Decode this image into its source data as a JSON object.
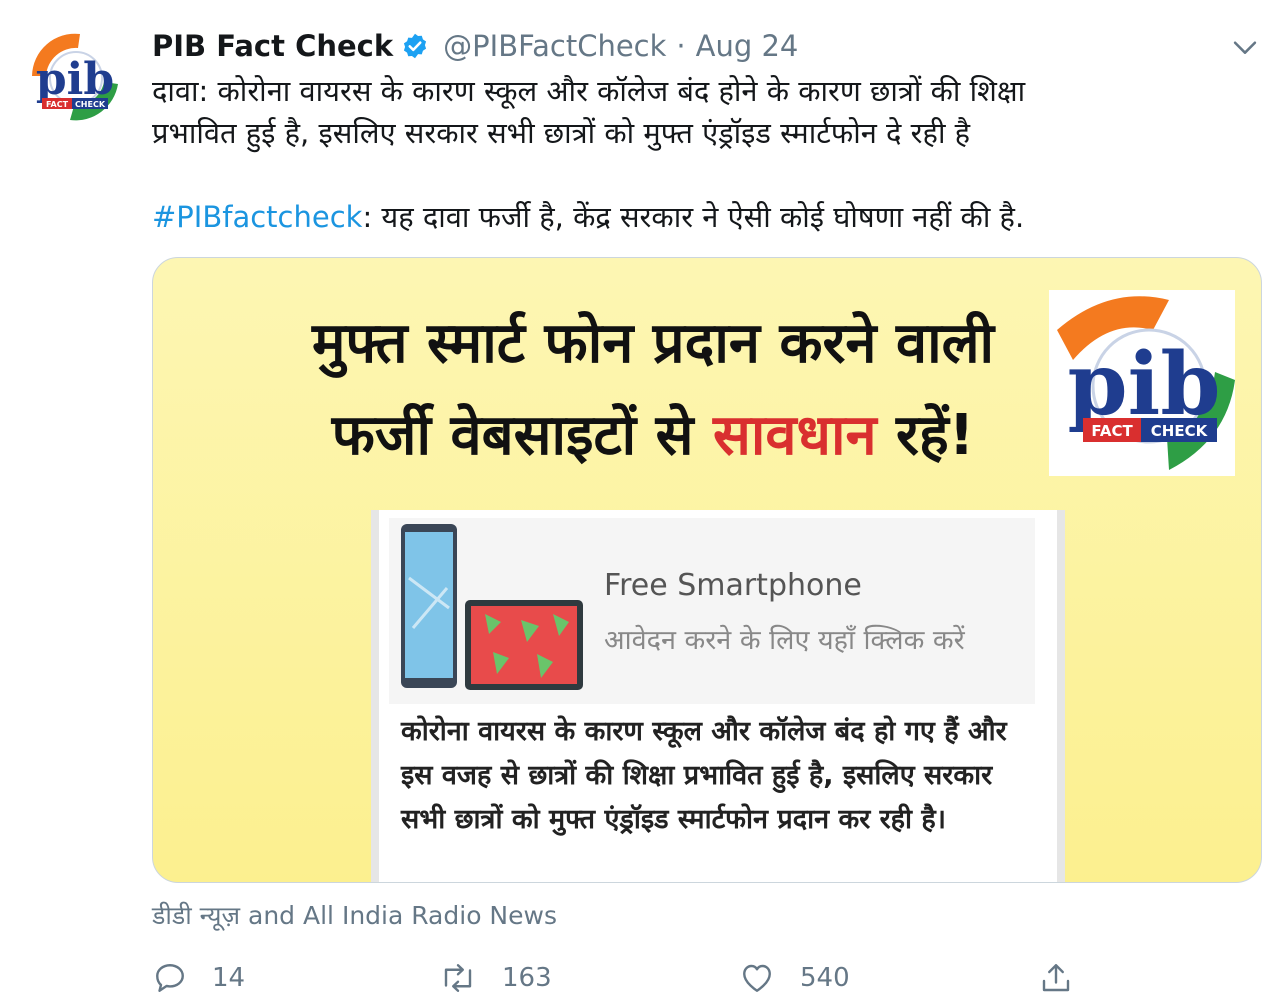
{
  "author": {
    "name": "PIB Fact Check",
    "handle": "@PIBFactCheck",
    "separator": "·",
    "date": "Aug 24",
    "verified": true,
    "avatar_label": "pib",
    "avatar_tag_left": "FACT",
    "avatar_tag_right": "CHECK"
  },
  "tweet": {
    "line1": "दावा: कोरोना वायरस के कारण स्कूल और कॉलेज बंद होने के कारण छात्रों की शिक्षा",
    "line2": "प्रभावित हुई है, इसलिए सरकार सभी छात्रों को मुफ्त एंड्रॉइड स्मार्टफोन दे रही है",
    "hashtag": "#PIBfactcheck",
    "verdict": ": यह दावा फर्जी है, केंद्र सरकार ने ऐसी कोई घोषणा नहीं की है."
  },
  "card": {
    "headline_line1": "मुफ्त स्मार्ट फोन प्रदान करने वाली",
    "headline_line2_pre": "फर्जी वेबसाइटों से ",
    "headline_warn": "सावधान",
    "headline_line2_post": " रहें!",
    "logo_label": "pib",
    "logo_tag_left": "FACT",
    "logo_tag_right": "CHECK",
    "ad_title": "Free Smartphone",
    "ad_subtitle": "आवेदन करने के लिए यहाँ क्लिक करें",
    "fake_message": "कोरोना वायरस के कारण स्कूल और कॉलेज बंद हो गए हैं और इस वजह से छात्रों की शिक्षा प्रभावित हुई है, इसलिए सरकार सभी छात्रों को मुफ्त एंड्रॉइड स्मार्टफोन प्रदान कर रही है।"
  },
  "attribution": "डीडी न्यूज़ and All India Radio News",
  "actions": {
    "replies": "14",
    "retweets": "163",
    "likes": "540"
  },
  "colors": {
    "link": "#1b95e0",
    "muted": "#657786",
    "warning": "#d92f2f",
    "card_bg": "#fdf3a0",
    "saffron": "#f47a1f",
    "green": "#2e9e45",
    "pib_blue": "#1f3d8f"
  },
  "icons": [
    "verified-badge-icon",
    "chevron-down-icon",
    "reply-icon",
    "retweet-icon",
    "like-icon",
    "share-icon"
  ]
}
